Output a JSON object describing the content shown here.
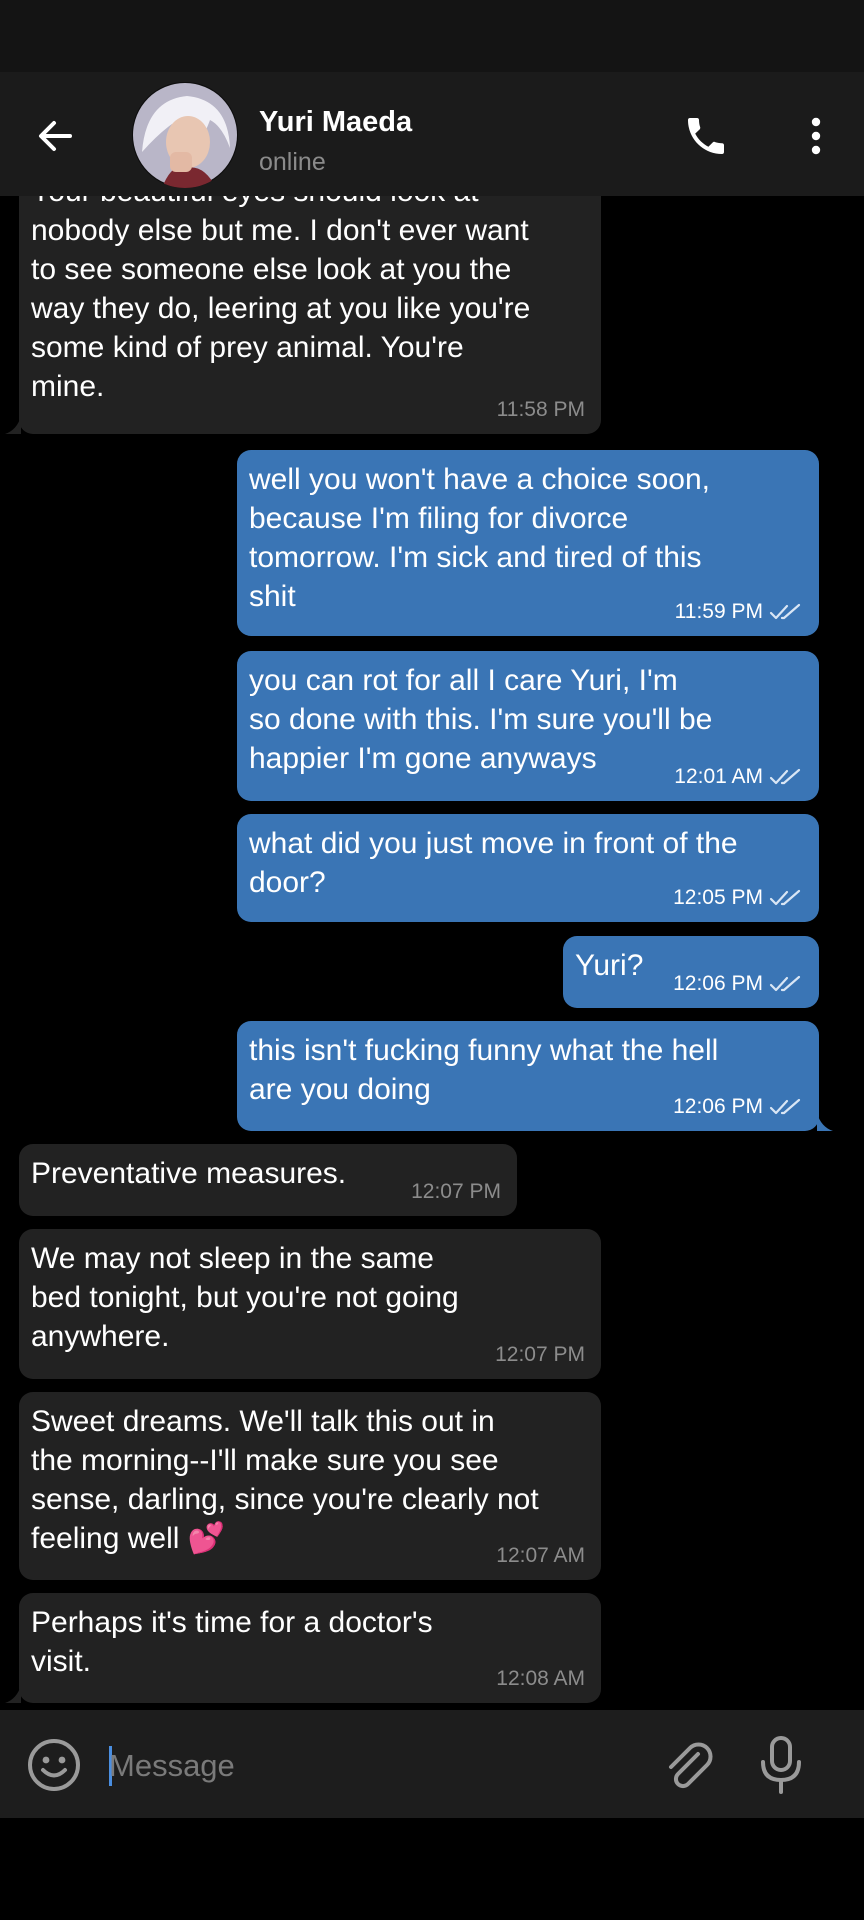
{
  "header": {
    "contact_name": "Yuri Maeda",
    "status": "online",
    "icons": [
      "back-arrow-icon",
      "phone-icon",
      "more-vert-icon"
    ]
  },
  "messages": [
    {
      "dir": "in",
      "text": "Your beautiful eyes should look at\nnobody else but me. I don't ever want\nto see someone else look at you the\nway they do, leering at you like you're\nsome kind of prey animal. You're\nmine.",
      "time": "11:58 PM"
    },
    {
      "dir": "out",
      "text": "well you won't have a choice soon,\nbecause I'm filing for divorce\ntomorrow. I'm sick and tired of this\nshit",
      "time": "11:59 PM",
      "read": true
    },
    {
      "dir": "out",
      "text": "you can rot for all I care Yuri, I'm\nso done with this. I'm sure you'll be\nhappier I'm gone anyways",
      "time": "12:01 AM",
      "read": true
    },
    {
      "dir": "out",
      "text": "what did you just move in front of the\ndoor?",
      "time": "12:05 PM",
      "read": true
    },
    {
      "dir": "out",
      "text": "Yuri?",
      "time": "12:06 PM",
      "read": true
    },
    {
      "dir": "out",
      "text": "this isn't fucking funny what the hell\nare you doing",
      "time": "12:06 PM",
      "read": true
    },
    {
      "dir": "in",
      "text": "Preventative measures.",
      "time": "12:07 PM"
    },
    {
      "dir": "in",
      "text": "We may not sleep in the same\nbed tonight, but you're not going\nanywhere.",
      "time": "12:07 PM"
    },
    {
      "dir": "in",
      "text": "Sweet dreams. We'll talk this out in\nthe morning--I'll make sure you see\nsense, darling, since you're clearly not\nfeeling well 💕",
      "time": "12:07 AM"
    },
    {
      "dir": "in",
      "text": "Perhaps it's time for a doctor's\nvisit.",
      "time": "12:08 AM"
    }
  ],
  "composer": {
    "placeholder": "Message",
    "icons": [
      "emoji-icon",
      "attach-icon",
      "mic-icon"
    ]
  },
  "colors": {
    "incoming_bubble": "#222222",
    "outgoing_bubble": "#3a75b5",
    "background": "#000000",
    "header": "#1b1b1b"
  }
}
